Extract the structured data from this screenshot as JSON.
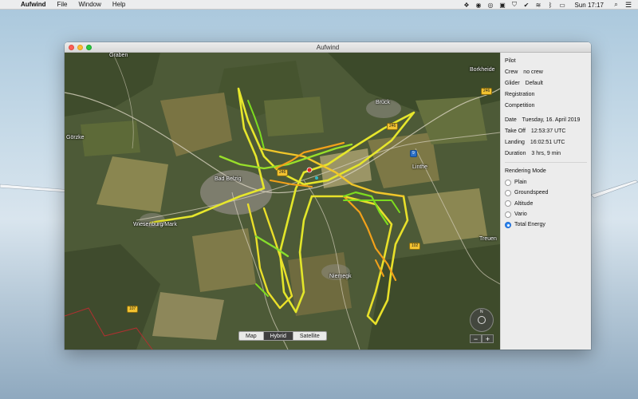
{
  "menubar": {
    "app_name": "Aufwind",
    "menus": [
      "File",
      "Window",
      "Help"
    ],
    "clock": "Sun 17:17"
  },
  "window": {
    "title": "Aufwind"
  },
  "map": {
    "places": [
      "Graben",
      "Borkheide",
      "Brück",
      "Linthe",
      "Bad Belzig",
      "Wiesenburg/Mark",
      "Niemegk",
      "Treuen",
      "Görzke"
    ],
    "road_shields": [
      "246",
      "246",
      "246",
      "9",
      "102",
      "107"
    ],
    "modes": [
      "Map",
      "Hybrid",
      "Satellite"
    ],
    "active_mode": "Hybrid",
    "zoom_in": "+",
    "zoom_out": "−",
    "compass": "N",
    "track_colors": {
      "low": "#7ddc1f",
      "mid": "#e8e82a",
      "high": "#f2a11a"
    }
  },
  "flight": {
    "pilot_label": "Pilot",
    "crew_label": "Crew",
    "crew_value": "no crew",
    "glider_label": "Glider",
    "glider_value": "Default",
    "registration_label": "Registration",
    "competition_label": "Competition",
    "date_label": "Date",
    "date_value": "Tuesday, 16. April 2019",
    "takeoff_label": "Take Off",
    "takeoff_value": "12:53:37 UTC",
    "landing_label": "Landing",
    "landing_value": "16:02:51 UTC",
    "duration_label": "Duration",
    "duration_value": "3 hrs, 9 min"
  },
  "rendering": {
    "title": "Rendering Mode",
    "options": [
      "Plain",
      "Groundspeed",
      "Altitude",
      "Vario",
      "Total Energy"
    ],
    "selected": "Total Energy"
  }
}
